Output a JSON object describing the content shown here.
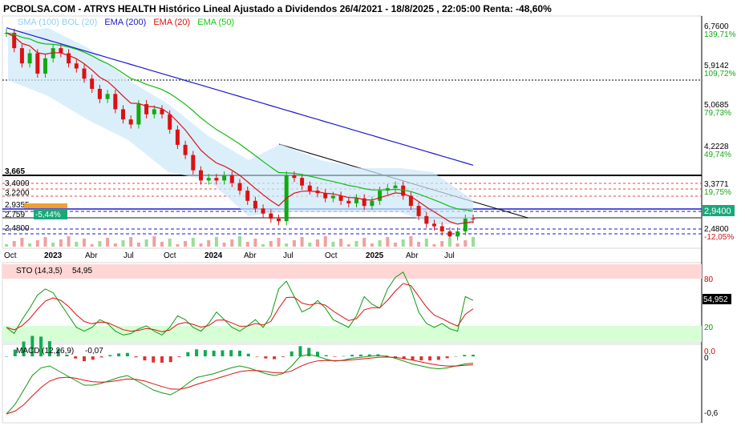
{
  "title": "PCBOLSA.COM - ATRYS HEALTH Histórico Lineal Ajustado a Dividendos 26/4/2021 - 18/8/2025 , 22:05:00 Renta: -48,60%",
  "legend": [
    {
      "label": "SMA (100) BOL (20)",
      "color": "#8fd0f0"
    },
    {
      "label": "EMA (200)",
      "color": "#1a1acc"
    },
    {
      "label": "EMA (20)",
      "color": "#dd1111"
    },
    {
      "label": "EMA (50)",
      "color": "#11cc11"
    }
  ],
  "chart_data": [
    {
      "type": "candlestick",
      "panel": "price",
      "x_ticks": [
        "Oct",
        "2023",
        "Abr",
        "Jul",
        "Oct",
        "2024",
        "Abr",
        "Jul",
        "Oct",
        "2025",
        "Abr",
        "Jul"
      ],
      "y_ticks_right": [
        {
          "price": "6,7600",
          "pct": "139,71%"
        },
        {
          "price": "5,9142",
          "pct": "109,72%"
        },
        {
          "price": "5,0685",
          "pct": "79,73%"
        },
        {
          "price": "4,2228",
          "pct": "49,74%"
        },
        {
          "price": "3,3771",
          "pct": "19,75%"
        },
        {
          "price": "2,4800",
          "pct": "-12,05%"
        }
      ],
      "last_price": "2,9400",
      "left_levels": [
        "3,665",
        "3,4000",
        "3,2200",
        "2,9355",
        "2,759",
        "2,4800"
      ],
      "left_badge": "-5,44%",
      "close_series": [
        6.6,
        6.3,
        6.0,
        6.2,
        5.8,
        6.1,
        6.3,
        6.2,
        6.0,
        5.9,
        5.7,
        5.5,
        5.3,
        5.4,
        5.1,
        4.9,
        4.8,
        5.2,
        5.0,
        5.1,
        5.0,
        4.7,
        4.4,
        4.2,
        3.9,
        3.7,
        3.75,
        3.7,
        3.8,
        3.65,
        3.5,
        3.3,
        3.15,
        3.05,
        2.95,
        2.9,
        3.8,
        3.75,
        3.6,
        3.5,
        3.45,
        3.35,
        3.4,
        3.3,
        3.25,
        3.35,
        3.2,
        3.3,
        3.5,
        3.55,
        3.6,
        3.4,
        3.2,
        3.0,
        2.85,
        2.8,
        2.7,
        2.6,
        2.7,
        2.95,
        2.94
      ],
      "series": [
        {
          "name": "EMA (200)",
          "y_start": 6.7,
          "y_end": 4.0
        },
        {
          "name": "EMA (50)",
          "y_start": 6.0,
          "y_end": 3.1
        },
        {
          "name": "EMA (20)",
          "y_start": 6.3,
          "y_end": 2.95
        }
      ]
    },
    {
      "type": "line",
      "panel": "stochastic",
      "label": "STO (14,3,5)",
      "value": "54,95",
      "last_value": "54,952",
      "y_ticks_right": [
        "80",
        "20"
      ],
      "values": [
        20,
        12,
        30,
        45,
        62,
        70,
        65,
        50,
        35,
        20,
        15,
        20,
        30,
        25,
        15,
        10,
        12,
        18,
        22,
        15,
        10,
        20,
        35,
        30,
        20,
        15,
        25,
        40,
        30,
        20,
        15,
        22,
        30,
        20,
        35,
        70,
        80,
        60,
        40,
        45,
        55,
        45,
        30,
        25,
        20,
        35,
        60,
        50,
        45,
        70,
        85,
        92,
        70,
        40,
        25,
        20,
        25,
        18,
        15,
        60,
        55
      ]
    },
    {
      "type": "line",
      "panel": "macd",
      "label": "MACD (12,26,9)",
      "value": "-0,07",
      "y_ticks_right": [
        "0,0",
        "0",
        "-0,6"
      ],
      "values": [
        -0.6,
        -0.5,
        -0.35,
        -0.2,
        -0.12,
        -0.1,
        -0.15,
        -0.2,
        -0.25,
        -0.3,
        -0.3,
        -0.28,
        -0.25,
        -0.22,
        -0.2,
        -0.25,
        -0.3,
        -0.35,
        -0.38,
        -0.4,
        -0.35,
        -0.28,
        -0.22,
        -0.2,
        -0.18,
        -0.15,
        -0.12,
        -0.1,
        -0.12,
        -0.15,
        -0.18,
        -0.2,
        -0.18,
        -0.1,
        0.0,
        0.02,
        0.0,
        -0.03,
        -0.05,
        -0.04,
        -0.02,
        -0.01,
        0.0,
        0.01,
        0.0,
        -0.02,
        -0.05,
        -0.08,
        -0.1,
        -0.12,
        -0.13,
        -0.12,
        -0.1,
        -0.08,
        -0.07
      ]
    }
  ]
}
